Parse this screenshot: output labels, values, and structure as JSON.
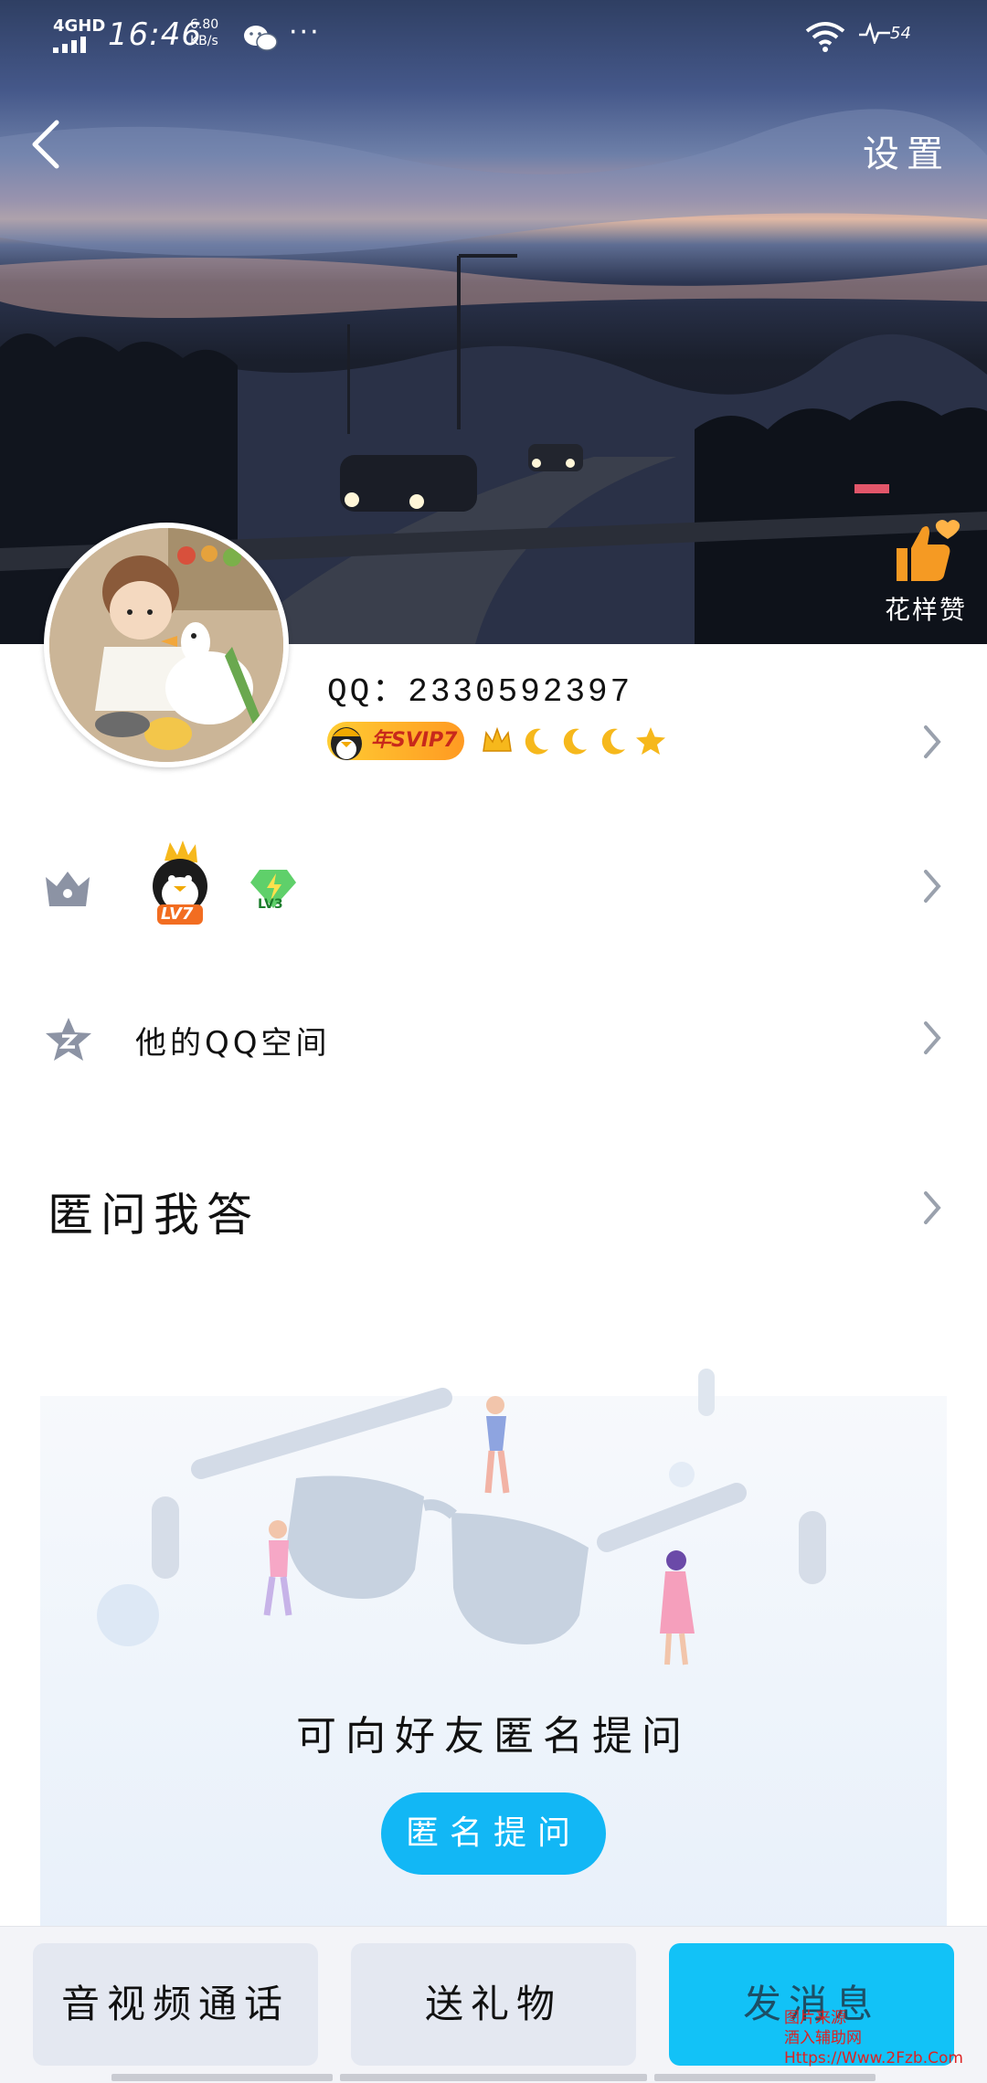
{
  "status_bar": {
    "network": "4GHD",
    "time": "16:46",
    "speed_value": "6.80",
    "speed_unit": "KB/s",
    "more": "···",
    "battery_level": "54"
  },
  "header": {
    "settings_label": "设置",
    "like_label": "花样赞"
  },
  "profile": {
    "qq_label": "QQ：",
    "qq_number": "2330592397",
    "svip_badge": "年SVIP7",
    "qq_level_badge": "LV7",
    "game_level_badge": "LV3"
  },
  "rows": {
    "qzone_label": "他的QQ空间"
  },
  "anonymous_qa": {
    "section_title": "匿问我答",
    "prompt_text": "可向好友匿名提问",
    "ask_button": "匿名提问"
  },
  "bottom_bar": {
    "call_button": "音视频通话",
    "gift_button": "送礼物",
    "message_button": "发消息"
  },
  "watermark": {
    "line1": "图片来源",
    "line2": "酒入辅助网",
    "line3": "Https://Www.2Fzb.Com"
  },
  "colors": {
    "accent": "#12b7f5",
    "like_orange": "#f59a23",
    "svip_gold": "#ffcc33"
  }
}
